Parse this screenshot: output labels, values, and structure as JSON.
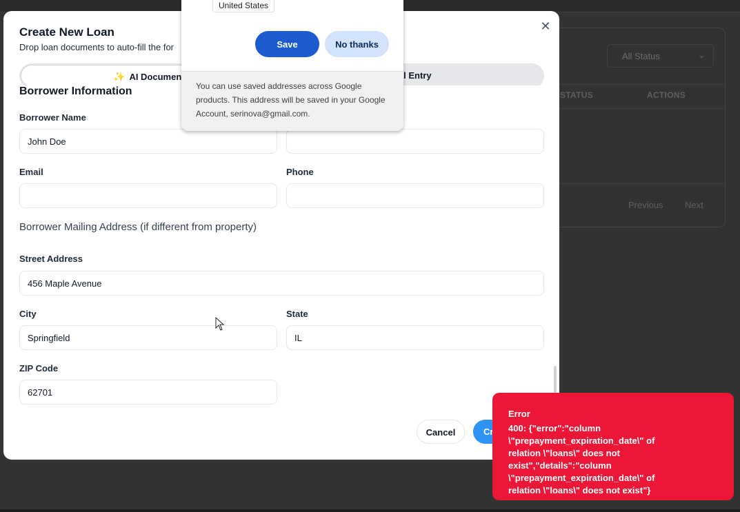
{
  "background": {
    "status_select": "All Status",
    "columns": [
      "STATUS",
      "ACTIONS"
    ],
    "pager": {
      "previous": "Previous",
      "next": "Next"
    }
  },
  "modal": {
    "title": "Create New Loan",
    "subtitle": "Drop loan documents to auto-fill the for",
    "tabs": {
      "ai": "AI Document Ana",
      "manual": "nual Entry"
    },
    "section_title": "Borrower Information",
    "fields": {
      "borrower_name": {
        "label": "Borrower Name",
        "value": "John Doe"
      },
      "email": {
        "label": "Email",
        "value": ""
      },
      "phone": {
        "label": "Phone",
        "value": ""
      },
      "mailing_heading": "Borrower Mailing Address (if different from property)",
      "street": {
        "label": "Street Address",
        "value": "456 Maple Avenue"
      },
      "city": {
        "label": "City",
        "value": "Springfield"
      },
      "state": {
        "label": "State",
        "value": "IL"
      },
      "zip": {
        "label": "ZIP Code",
        "value": "62701"
      }
    },
    "buttons": {
      "cancel": "Cancel",
      "create": "Cr"
    }
  },
  "address_popup": {
    "country_chip": "United States",
    "save": "Save",
    "no_thanks": "No thanks",
    "footer_text": "You can use saved addresses across Google products. This address will be saved in your Google Account, serinova@gmail.com."
  },
  "error_toast": {
    "title": "Error",
    "message": "400: {\"error\":\"column \\\"prepayment_expiration_date\\\" of relation \\\"loans\\\" does not exist\",\"details\":\"column \\\"prepayment_expiration_date\\\" of relation \\\"loans\\\" does not exist\"}"
  },
  "colors": {
    "toast_bg": "#ec1737",
    "save_button": "#1b5bcf",
    "create_button": "#2e93f5"
  }
}
